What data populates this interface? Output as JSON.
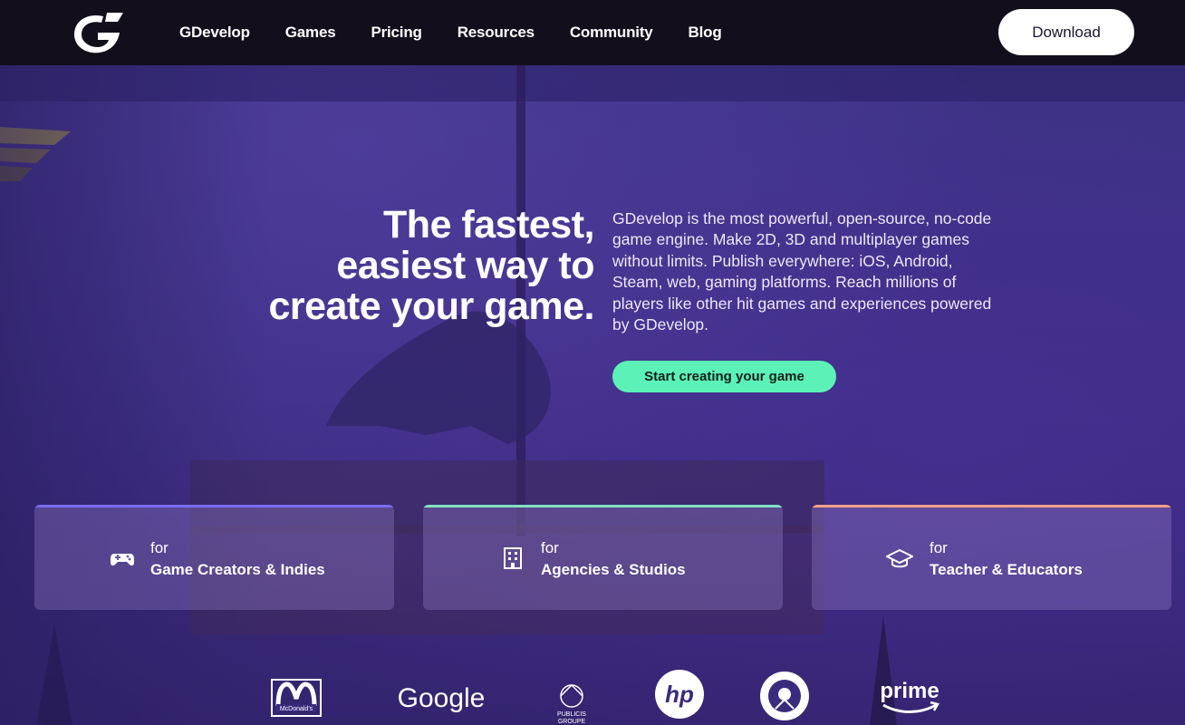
{
  "nav": {
    "logo_name": "gdevelop-logo",
    "items": [
      {
        "label": "GDevelop"
      },
      {
        "label": "Games"
      },
      {
        "label": "Pricing"
      },
      {
        "label": "Resources"
      },
      {
        "label": "Community"
      },
      {
        "label": "Blog"
      }
    ],
    "download_label": "Download"
  },
  "hero": {
    "headline_lines": [
      "The fastest,",
      "easiest way to",
      "create your game."
    ],
    "intro": "GDevelop is the most powerful, open-source, no-code game engine. Make 2D, 3D and multiplayer games without limits. Publish everywhere: iOS, Android, Steam, web, gaming platforms. Reach millions of players like other hit games and experiences powered by GDevelop.",
    "cta_label": "Start creating your game"
  },
  "audiences": [
    {
      "prefix": "for",
      "title": "Game Creators & Indies",
      "icon": "gamepad-icon",
      "accent": "#7b6cf0"
    },
    {
      "prefix": "for",
      "title": "Agencies & Studios",
      "icon": "building-icon",
      "accent": "#7fe3c2"
    },
    {
      "prefix": "for",
      "title": "Teacher & Educators",
      "icon": "graduation-cap-icon",
      "accent": "#f2a08a"
    }
  ],
  "brands": [
    {
      "name": "McDonald's",
      "icon": "mcdonalds-logo"
    },
    {
      "name": "Google",
      "icon": "google-logo"
    },
    {
      "name": "PUBLICIS GROUPE",
      "icon": "publicis-logo"
    },
    {
      "name": "hp",
      "icon": "hp-logo"
    },
    {
      "name": "Starbucks",
      "icon": "starbucks-logo"
    },
    {
      "name": "prime",
      "icon": "prime-logo"
    }
  ],
  "colors": {
    "topbar": "#130e1c",
    "cta": "#5cf2b7",
    "background": "#3c2f84"
  }
}
